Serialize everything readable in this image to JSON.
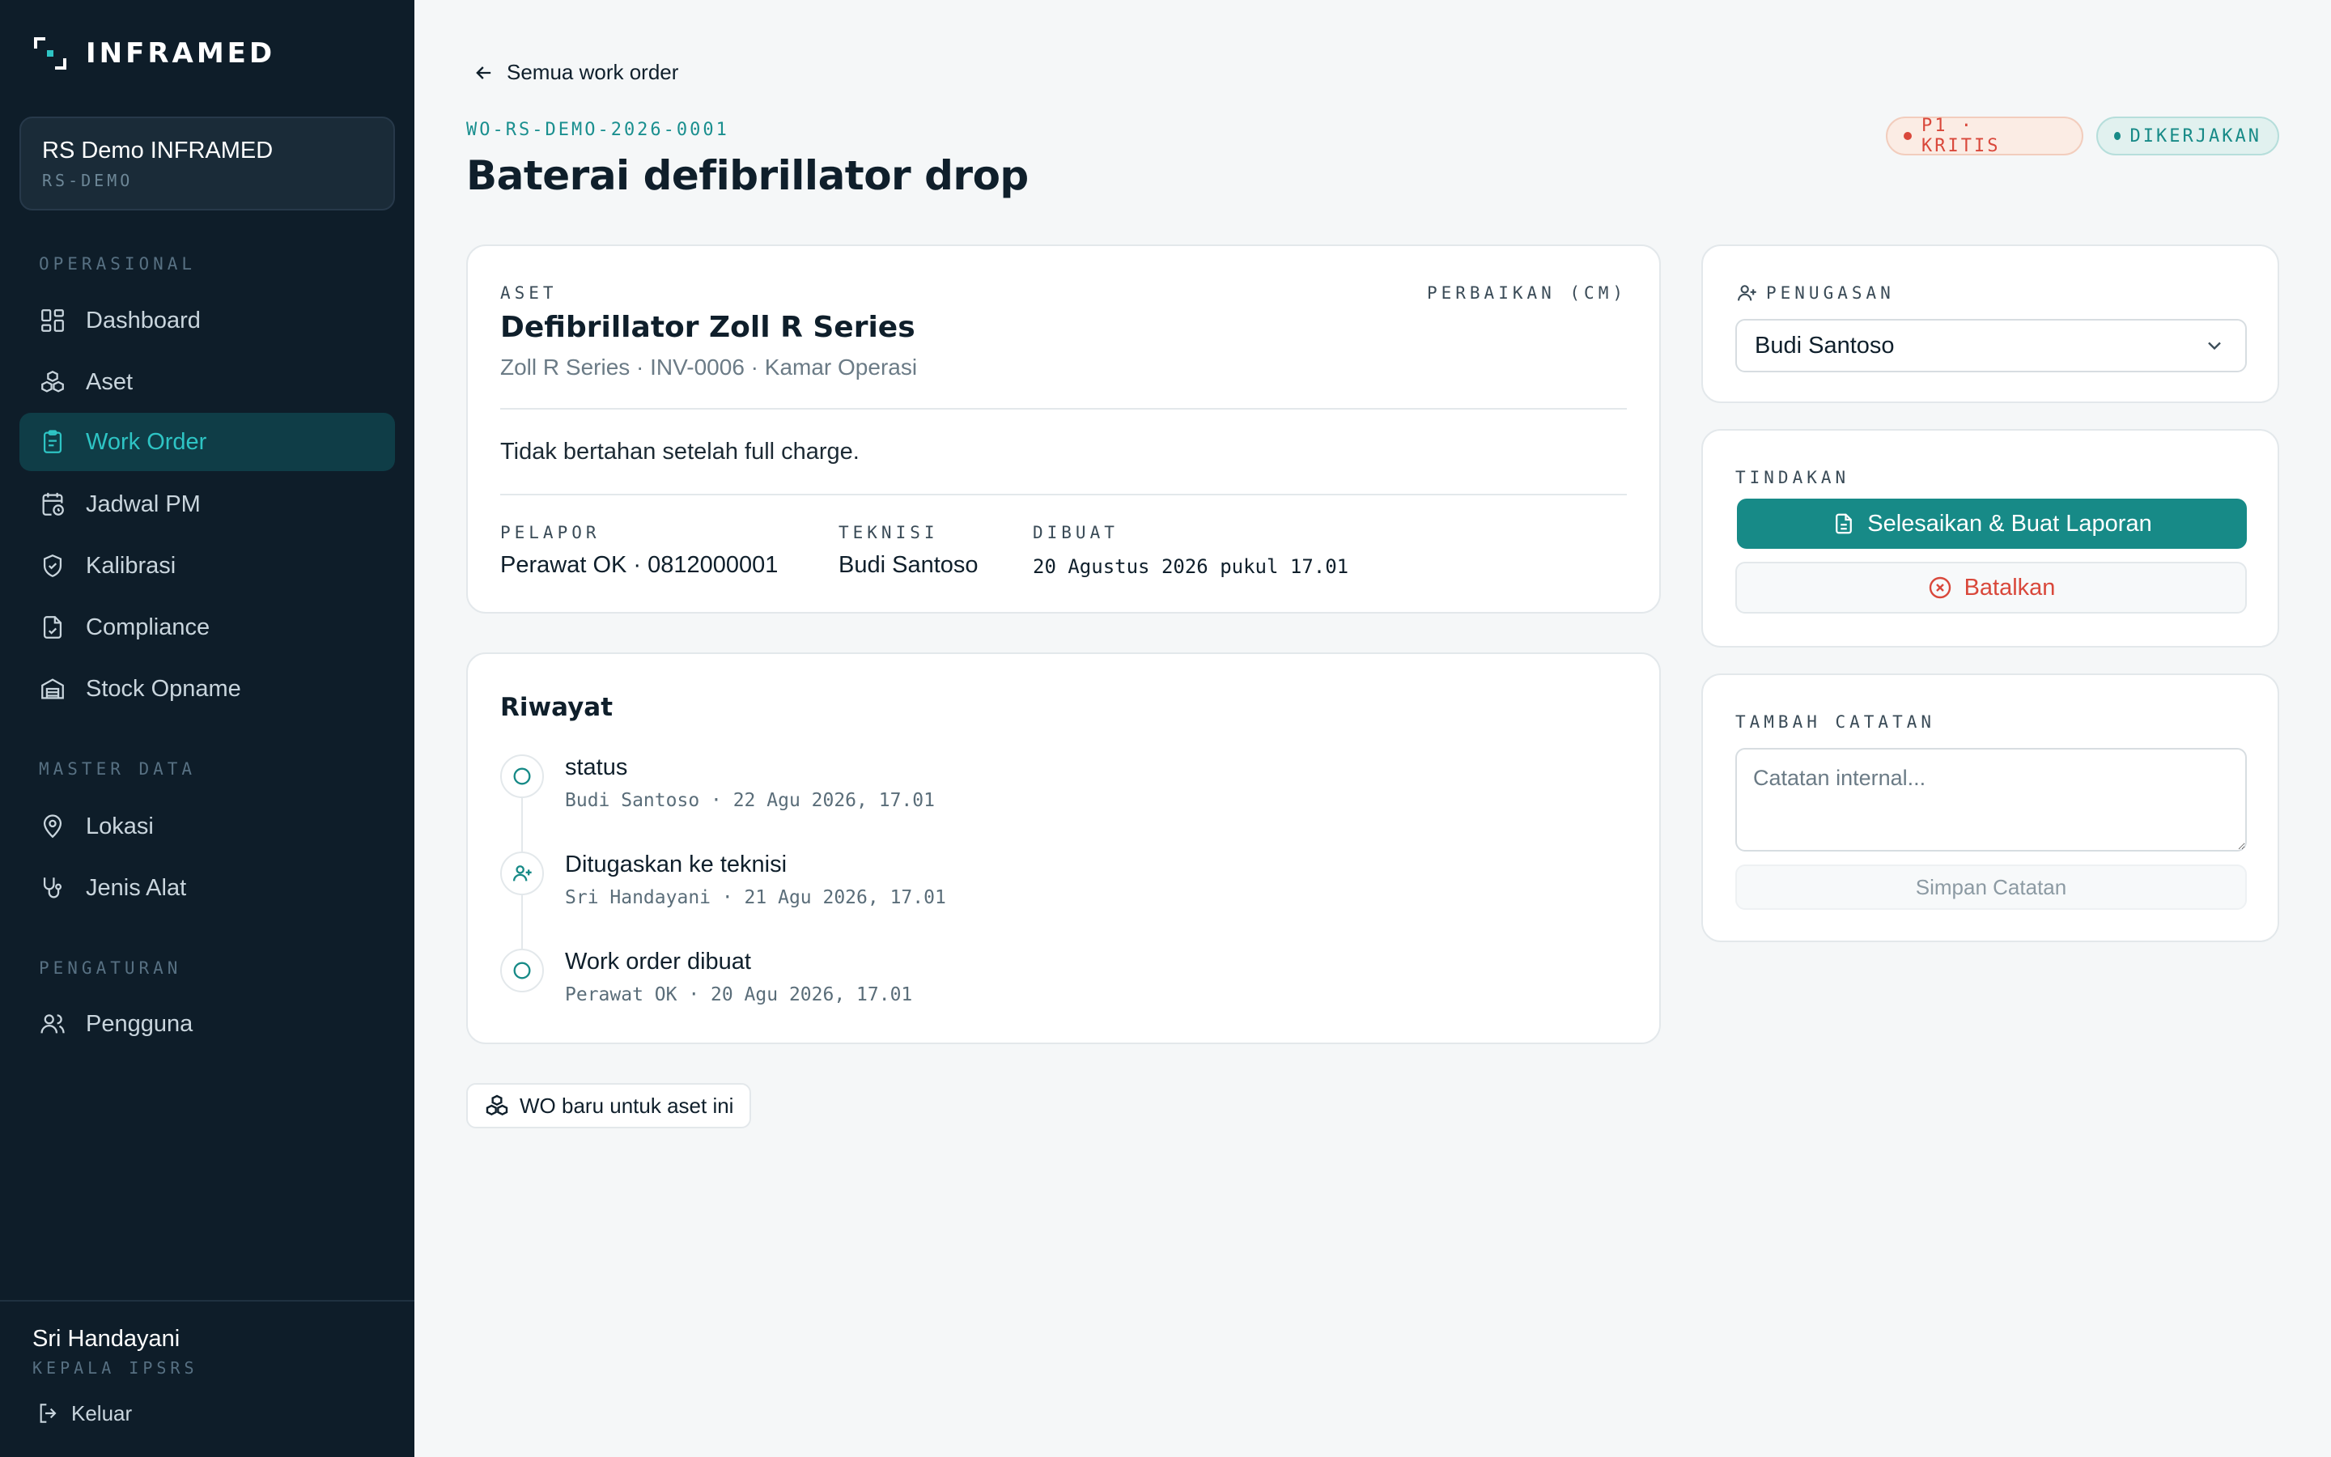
{
  "brand": {
    "name": "INFRAMED",
    "icon": "frame-logo-icon"
  },
  "org": {
    "name": "RS Demo INFRAMED",
    "code": "RS-DEMO"
  },
  "sidebar": {
    "sections": [
      {
        "label": "OPERASIONAL"
      },
      {
        "label": "MASTER DATA"
      },
      {
        "label": "PENGATURAN"
      }
    ],
    "items": [
      {
        "label": "Dashboard",
        "icon": "dashboard-icon"
      },
      {
        "label": "Aset",
        "icon": "boxes-icon"
      },
      {
        "label": "Work Order",
        "icon": "clipboard-icon",
        "active": true
      },
      {
        "label": "Jadwal PM",
        "icon": "calendar-clock-icon"
      },
      {
        "label": "Kalibrasi",
        "icon": "shield-check-icon"
      },
      {
        "label": "Compliance",
        "icon": "file-check-icon"
      },
      {
        "label": "Stock Opname",
        "icon": "warehouse-icon"
      },
      {
        "label": "Lokasi",
        "icon": "map-pin-icon"
      },
      {
        "label": "Jenis Alat",
        "icon": "stethoscope-icon"
      },
      {
        "label": "Pengguna",
        "icon": "users-icon"
      }
    ]
  },
  "user": {
    "name": "Sri Handayani",
    "role": "KEPALA IPSRS",
    "logout_label": "Keluar"
  },
  "header": {
    "back_label": "Semua work order",
    "wo_code": "WO-RS-DEMO-2026-0001",
    "title": "Baterai defibrillator drop",
    "priority_badge": "P1 · KRITIS",
    "status_badge": "DIKERJAKAN"
  },
  "asset": {
    "section_label": "ASET",
    "type_label": "PERBAIKAN (CM)",
    "name": "Defibrillator Zoll R Series",
    "subtitle": "Zoll R Series · INV-0006 · Kamar Operasi",
    "description": "Tidak bertahan setelah full charge.",
    "reporter_label": "PELAPOR",
    "reporter_value": "Perawat OK · 0812000001",
    "technician_label": "TEKNISI",
    "technician_value": "Budi Santoso",
    "created_label": "DIBUAT",
    "created_value": "20 Agustus 2026 pukul 17.01"
  },
  "history": {
    "title": "Riwayat",
    "items": [
      {
        "title": "status",
        "meta": "Budi Santoso · 22 Agu 2026, 17.01",
        "icon": "circle-icon"
      },
      {
        "title": "Ditugaskan ke teknisi",
        "meta": "Sri Handayani · 21 Agu 2026, 17.01",
        "icon": "user-plus-icon"
      },
      {
        "title": "Work order dibuat",
        "meta": "Perawat OK · 20 Agu 2026, 17.01",
        "icon": "circle-icon"
      }
    ]
  },
  "new_wo_button": "WO baru untuk aset ini",
  "assignment": {
    "label": "PENUGASAN",
    "selected": "Budi Santoso"
  },
  "actions": {
    "label": "TINDAKAN",
    "complete_label": "Selesaikan & Buat Laporan",
    "cancel_label": "Batalkan"
  },
  "note": {
    "label": "TAMBAH CATATAN",
    "placeholder": "Catatan internal...",
    "save_label": "Simpan Catatan"
  },
  "colors": {
    "sidebar_bg": "#0e1d29",
    "accent": "#178a87",
    "danger": "#d9483b",
    "page_bg": "#f5f7f8"
  }
}
